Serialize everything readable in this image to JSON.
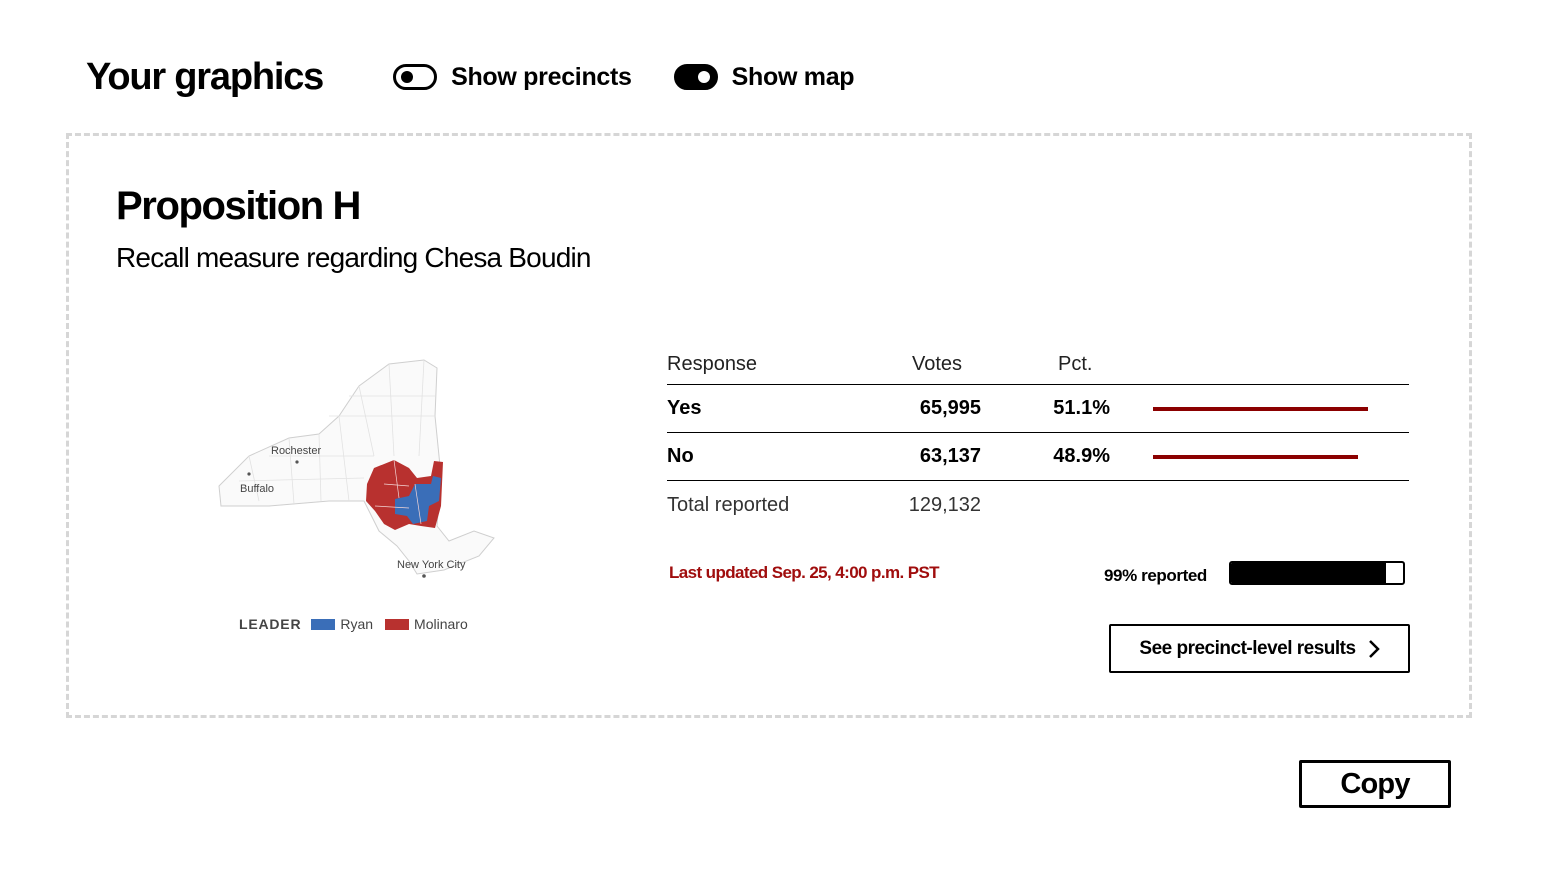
{
  "header": {
    "title": "Your graphics",
    "toggles": [
      {
        "label": "Show precincts",
        "on": false
      },
      {
        "label": "Show map",
        "on": true
      }
    ]
  },
  "card": {
    "title": "Proposition H",
    "subtitle": "Recall measure regarding Chesa Boudin"
  },
  "map": {
    "cities": [
      "Rochester",
      "Buffalo",
      "New York City"
    ],
    "legend": {
      "title": "LEADER",
      "items": [
        {
          "name": "Ryan",
          "color": "#3a6eb8"
        },
        {
          "name": "Molinaro",
          "color": "#b8312f"
        }
      ]
    }
  },
  "results": {
    "columns": [
      "Response",
      "Votes",
      "Pct."
    ],
    "rows": [
      {
        "response": "Yes",
        "votes": "65,995",
        "pct": "51.1%",
        "share": 51.1
      },
      {
        "response": "No",
        "votes": "63,137",
        "pct": "48.9%",
        "share": 48.9
      }
    ],
    "total_label": "Total reported",
    "total_votes": "129,132",
    "bar_color": "#8b0000"
  },
  "status": {
    "updated": "Last updated Sep. 25, 4:00 p.m. PST",
    "reported_label": "99% reported",
    "reported_pct": 90
  },
  "buttons": {
    "precinct": "See precinct-level results",
    "copy": "Copy"
  }
}
